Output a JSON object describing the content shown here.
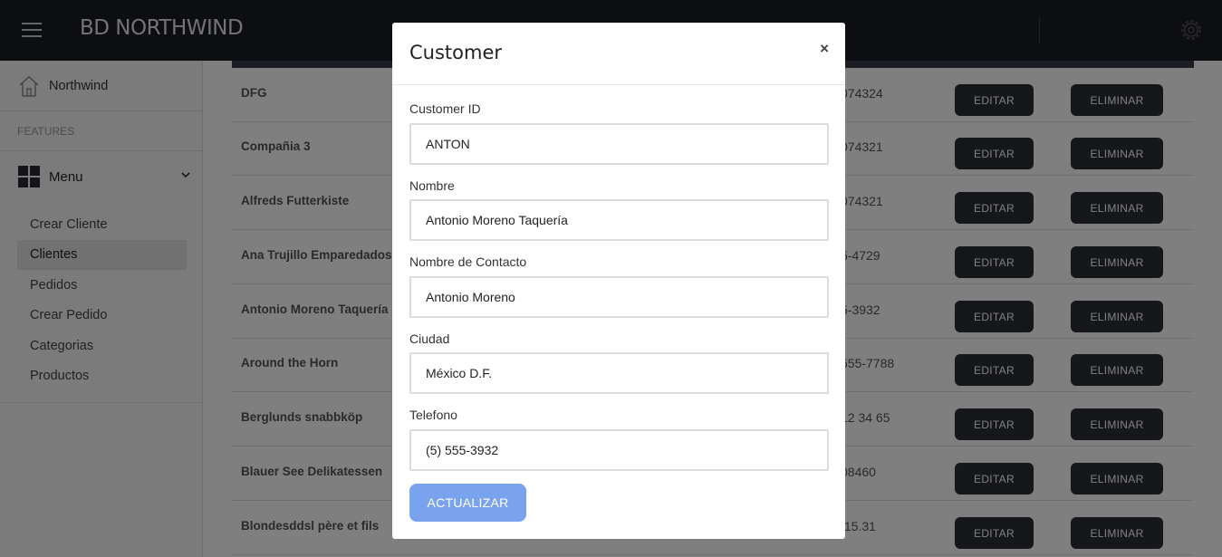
{
  "app": {
    "brand": "BD NORTHWIND"
  },
  "sidebar": {
    "home_label": "Northwind",
    "section_label": "FEATURES",
    "menu_label": "Menu",
    "items": [
      "Crear Cliente",
      "Clientes",
      "Pedidos",
      "Crear Pedido",
      "Categorias",
      "Productos"
    ],
    "active_item": "Clientes"
  },
  "table": {
    "edit_label": "EDITAR",
    "delete_label": "ELIMINAR",
    "rows": [
      {
        "name": "DFG",
        "phone": "074324"
      },
      {
        "name": "Compañia 3",
        "phone": "074321"
      },
      {
        "name": "Alfreds Futterkiste",
        "phone": "074321"
      },
      {
        "name": "Ana Trujillo Emparedados y",
        "phone": "5-4729"
      },
      {
        "name": "Antonio Moreno Taquería",
        "phone": "5-3932"
      },
      {
        "name": "Around the Horn",
        "phone": "555-7788"
      },
      {
        "name": "Berglunds snabbköp",
        "phone": "12 34 65"
      },
      {
        "name": "Blauer See Delikatessen",
        "phone": "08460"
      },
      {
        "name": "Blondesddsl père et fils",
        "phone": ".15.31"
      }
    ]
  },
  "modal": {
    "title": "Customer",
    "close": "×",
    "fields": [
      {
        "label": "Customer ID",
        "value": "ANTON"
      },
      {
        "label": "Nombre",
        "value": "Antonio Moreno Taquería"
      },
      {
        "label": "Nombre de Contacto",
        "value": "Antonio Moreno"
      },
      {
        "label": "Ciudad",
        "value": "México D.F."
      },
      {
        "label": "Telefono",
        "value": "(5) 555-3932"
      }
    ],
    "submit_label": "ACTUALIZAR"
  },
  "colors": {
    "topbar": "#1b1c24",
    "button_dark": "#2b2e36",
    "submit_button": "#7aa3ee"
  }
}
